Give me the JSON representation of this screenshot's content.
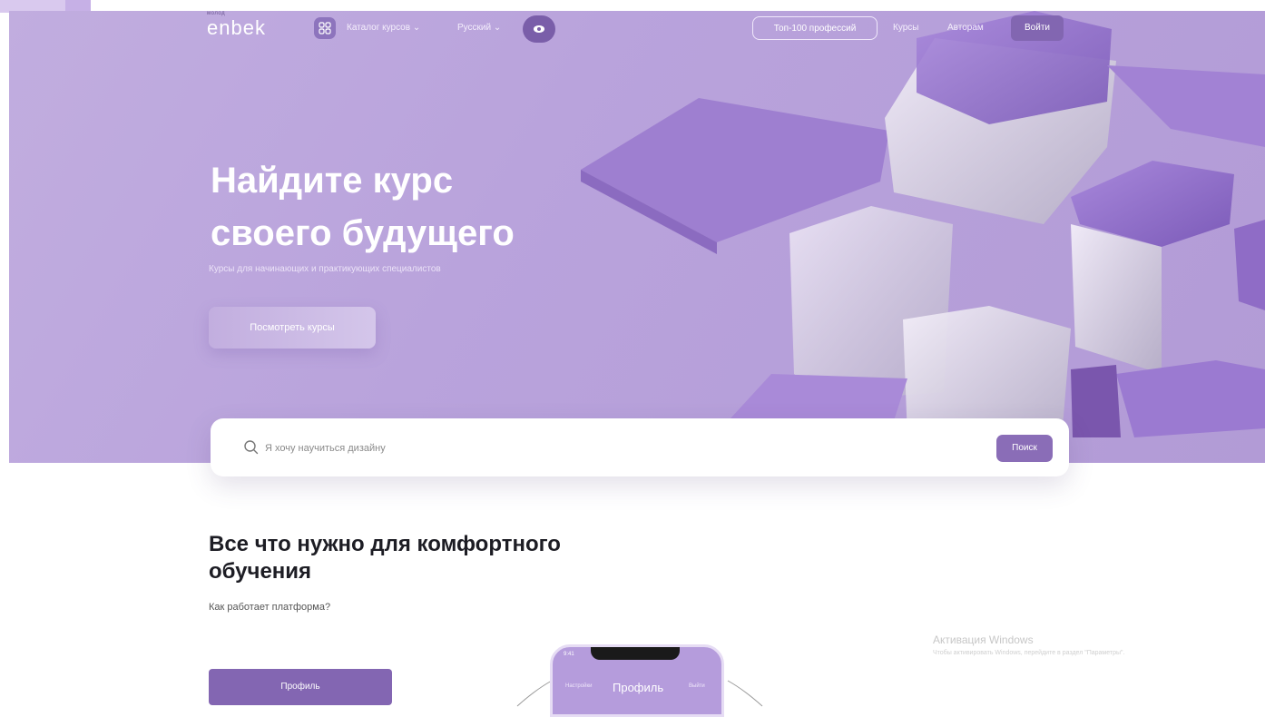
{
  "header": {
    "brand_small": "молод",
    "brand": "enbek",
    "nav_catalog": "Каталог курсов ⌄",
    "nav_language": "Русский ⌄",
    "top100": "Топ-100 профессий",
    "courses": "Курсы",
    "authors": "Авторам",
    "login": "Войти"
  },
  "hero": {
    "title": "Найдите курс\nсвоего будущего",
    "subtitle": "Курсы для начинающих и практикующих специалистов",
    "cta": "Посмотреть курсы"
  },
  "search": {
    "placeholder": "Я хочу научиться дизайну",
    "button": "Поиск"
  },
  "section": {
    "title": "Все что нужно для комфортного обучения",
    "subtitle": "Как работает платформа?",
    "profile_button": "Профиль"
  },
  "phone": {
    "time": "9:41",
    "title": "Профиль",
    "left": "Настройки",
    "right": "Выйти"
  },
  "watermark": {
    "title": "Активация Windows",
    "subtitle": "Чтобы активировать Windows, перейдите в раздел \"Параметры\"."
  },
  "icons": [
    "grid-icon",
    "eye-icon",
    "search-icon"
  ],
  "colors": {
    "hero": "#b9a3dc",
    "accent": "#8366b2",
    "accent_dark": "#7a5ea9"
  }
}
